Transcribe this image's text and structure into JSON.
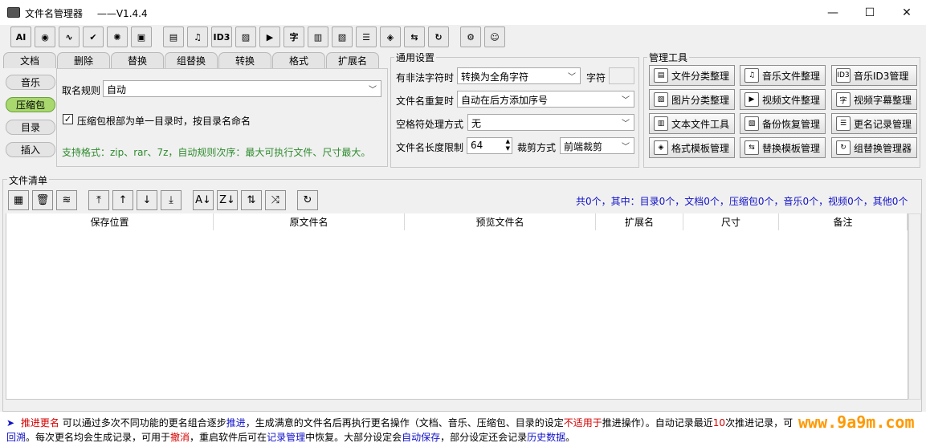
{
  "window": {
    "title": "文件名管理器",
    "version": "——V1.4.4"
  },
  "window_controls": {
    "minimize": "—",
    "maximize": "☐",
    "close": "✕"
  },
  "toolbar": {
    "buttons": [
      {
        "name": "ai-icon",
        "glyph": "AI"
      },
      {
        "name": "eye-icon",
        "glyph": "◉"
      },
      {
        "name": "wave-icon",
        "glyph": "∿"
      },
      {
        "name": "check-icon",
        "glyph": "✔"
      },
      {
        "name": "sparkle-icon",
        "glyph": "✺"
      },
      {
        "name": "save-icon",
        "glyph": "▣"
      },
      {
        "name": "file-category-icon",
        "glyph": "▤"
      },
      {
        "name": "music-file-icon",
        "glyph": "♫"
      },
      {
        "name": "id3-icon",
        "glyph": "ID3"
      },
      {
        "name": "image-file-icon",
        "glyph": "▨"
      },
      {
        "name": "video-file-icon",
        "glyph": "▶"
      },
      {
        "name": "subtitle-icon",
        "glyph": "字"
      },
      {
        "name": "text-file-icon",
        "glyph": "▥"
      },
      {
        "name": "backup-icon",
        "glyph": "▧"
      },
      {
        "name": "rename-log-icon",
        "glyph": "☰"
      },
      {
        "name": "format-template-icon",
        "glyph": "◈"
      },
      {
        "name": "replace-template-icon",
        "glyph": "⇆"
      },
      {
        "name": "group-replace-icon",
        "glyph": "↻"
      },
      {
        "name": "gear-icon",
        "glyph": "⚙"
      },
      {
        "name": "chat-icon",
        "glyph": "☺"
      }
    ]
  },
  "tabs": [
    "文档",
    "删除",
    "替换",
    "组替换",
    "转换",
    "格式",
    "扩展名"
  ],
  "side_tabs": [
    "音乐",
    "压缩包",
    "目录",
    "插入"
  ],
  "rename_rule": {
    "label": "取名规则",
    "value": "自动"
  },
  "archive_option": {
    "checked": true,
    "label": "压缩包根部为单一目录时，按目录名命名"
  },
  "support_text": "支持格式：zip、rar、7z，自动规则次序：最大可执行文件、尺寸最大。",
  "general": {
    "title": "通用设置",
    "illegal_char_label": "有非法字符时",
    "illegal_char_value": "转换为全角字符",
    "char_label": "字符",
    "char_value": "",
    "duplicate_label": "文件名重复时",
    "duplicate_value": "自动在后方添加序号",
    "space_label": "空格符处理方式",
    "space_value": "无",
    "length_label": "文件名长度限制",
    "length_value": "64",
    "crop_label": "裁剪方式",
    "crop_value": "前端裁剪"
  },
  "tools": {
    "title": "管理工具",
    "items": [
      {
        "label": "文件分类整理",
        "icon": "▤"
      },
      {
        "label": "音乐文件整理",
        "icon": "♫"
      },
      {
        "label": "音乐ID3管理",
        "icon": "ID3"
      },
      {
        "label": "图片分类整理",
        "icon": "▨"
      },
      {
        "label": "视频文件整理",
        "icon": "▶"
      },
      {
        "label": "视频字幕整理",
        "icon": "字"
      },
      {
        "label": "文本文件工具",
        "icon": "▥"
      },
      {
        "label": "备份恢复管理",
        "icon": "▧"
      },
      {
        "label": "更名记录管理",
        "icon": "☰"
      },
      {
        "label": "格式模板管理",
        "icon": "◈"
      },
      {
        "label": "替换模板管理",
        "icon": "⇆"
      },
      {
        "label": "组替换管理器",
        "icon": "↻"
      }
    ]
  },
  "file_list": {
    "title": "文件清单",
    "summary": "共0个，其中：目录0个，文档0个，压缩包0个，音乐0个，视频0个，其他0个",
    "buttons": [
      {
        "name": "add-files-icon",
        "glyph": "▦"
      },
      {
        "name": "trash-icon",
        "glyph": "🗑"
      },
      {
        "name": "clear-icon",
        "glyph": "≋"
      },
      {
        "name": "move-top-icon",
        "glyph": "⤒"
      },
      {
        "name": "move-up-icon",
        "glyph": "↑"
      },
      {
        "name": "move-down-icon",
        "glyph": "↓"
      },
      {
        "name": "move-bottom-icon",
        "glyph": "⤓"
      },
      {
        "name": "sort-asc-icon",
        "glyph": "A↓"
      },
      {
        "name": "sort-desc-icon",
        "glyph": "Z↓"
      },
      {
        "name": "swap-icon",
        "glyph": "⇅"
      },
      {
        "name": "shuffle-icon",
        "glyph": "⤨"
      },
      {
        "name": "refresh-icon",
        "glyph": "↻"
      }
    ],
    "columns": [
      "保存位置",
      "原文件名",
      "预览文件名",
      "扩展名",
      "尺寸",
      "备注"
    ]
  },
  "bottom": {
    "arrow": "➤",
    "line1": [
      {
        "text": "推进更名",
        "cls": "red"
      },
      {
        "text": " 可以通过多次不同功能的更名组合逐步",
        "cls": ""
      },
      {
        "text": "推进",
        "cls": "blue"
      },
      {
        "text": "，生成满意的文件名后再执行更名操作（文档、音乐、压缩包、目录的设定",
        "cls": ""
      },
      {
        "text": "不适用于",
        "cls": "red"
      },
      {
        "text": "推进操作）。自动记录最近",
        "cls": ""
      },
      {
        "text": "10",
        "cls": "red"
      },
      {
        "text": "次推进记录，可",
        "cls": ""
      }
    ],
    "line2": [
      {
        "text": "回溯",
        "cls": "blue"
      },
      {
        "text": "。每次更名均会生成记录，可用于",
        "cls": ""
      },
      {
        "text": "撤消",
        "cls": "red"
      },
      {
        "text": "，重启软件后可在",
        "cls": ""
      },
      {
        "text": "记录管理",
        "cls": "blue"
      },
      {
        "text": "中恢复。大部分设定会",
        "cls": ""
      },
      {
        "text": "自动保存",
        "cls": "blue"
      },
      {
        "text": "，部分设定还会记录",
        "cls": ""
      },
      {
        "text": "历史数据",
        "cls": "blue"
      },
      {
        "text": "。",
        "cls": ""
      }
    ]
  },
  "watermark": "www.9a9m.com",
  "colors": {
    "active_tab": "#a9d86f",
    "support_text": "#2e8b2e",
    "summary": "#1010c8",
    "red": "#d40000",
    "watermark": "#ff9900"
  }
}
